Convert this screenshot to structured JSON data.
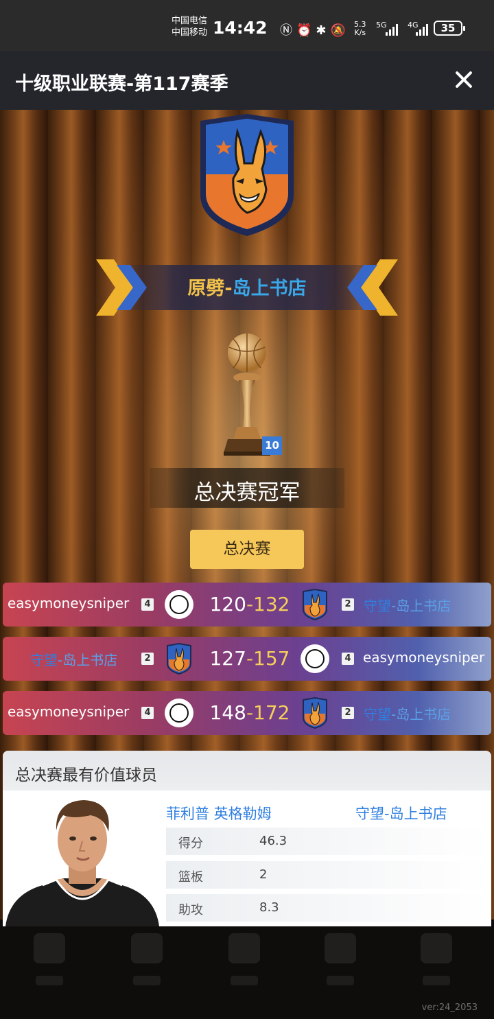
{
  "status_bar": {
    "carrier1": "中国电信",
    "carrier2": "中国移动",
    "time": "14:42",
    "net_speed_value": "5.3",
    "net_speed_unit": "K/s",
    "sig1": "5G",
    "sig2": "4G",
    "battery": "35"
  },
  "header": {
    "title": "十级职业联赛-第117赛季"
  },
  "champion_banner": {
    "team_prefix": "原劈-",
    "team_suffix": "岛上书店"
  },
  "trophy": {
    "badge": "10",
    "title": "总决赛冠军"
  },
  "finals_button": "总决赛",
  "games": [
    {
      "left_name": "easymoneysniper",
      "left_badge": "4",
      "score_left": "120",
      "sep": "-",
      "score_right": "132",
      "right_badge": "2",
      "right_prefix": "守望",
      "right_suffix": "-岛上书店"
    },
    {
      "left_prefix": "守望",
      "left_suffix": "-岛上书店",
      "left_badge": "2",
      "score_left": "127",
      "sep": "-",
      "score_right": "157",
      "right_badge": "4",
      "right_name": "easymoneysniper"
    },
    {
      "left_name": "easymoneysniper",
      "left_badge": "4",
      "score_left": "148",
      "sep": "-",
      "score_right": "172",
      "right_badge": "2",
      "right_prefix": "守望",
      "right_suffix": "-岛上书店"
    }
  ],
  "mvp": {
    "section_title": "总决赛最有价值球员",
    "player_name": "菲利普 英格勒姆",
    "team_prefix": "守望",
    "team_suffix": "-岛上书店",
    "stats": [
      {
        "label": "得分",
        "value": "46.3"
      },
      {
        "label": "篮板",
        "value": "2"
      },
      {
        "label": "助攻",
        "value": "8.3"
      }
    ]
  },
  "version": "ver:24_2053",
  "colors": {
    "accent_gold": "#f6c85a",
    "team_blue": "#2f7fe0",
    "banner_gold": "#f2c34a"
  }
}
